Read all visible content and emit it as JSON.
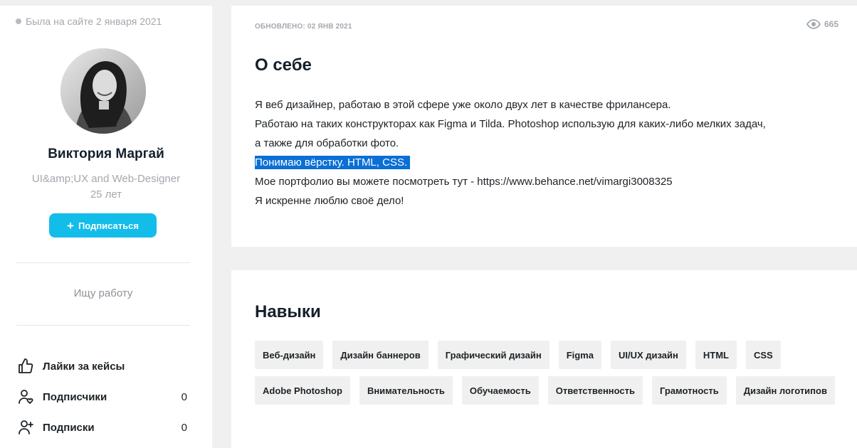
{
  "sidebar": {
    "last_seen": "Была на сайте 2 января 2021",
    "name": "Виктория Маргай",
    "title": "UI&amp;UX and Web-Designer",
    "age": "25 лет",
    "subscribe_label": "Подписаться",
    "job_status": "Ищу работу",
    "stats": [
      {
        "label": "Лайки за кейсы",
        "count": "",
        "icon": "thumbs-up-icon"
      },
      {
        "label": "Подписчики",
        "count": "0",
        "icon": "user-heart-icon"
      },
      {
        "label": "Подписки",
        "count": "0",
        "icon": "user-plus-icon"
      }
    ]
  },
  "about": {
    "updated": "ОБНОВЛЕНО: 02 ЯНВ 2021",
    "views": "665",
    "title": "О себе",
    "lines": [
      "Я веб дизайнер, работаю в этой сфере уже около двух лет в качестве фрилансера.",
      "Работаю на таких конструкторах как Figma и Tilda. Photoshop использую для каких-либо мелких задач,",
      "а также для обработки фото.",
      "Понимаю вёрстку. HTML, CSS.",
      "Мое портфолио вы можете посмотреть тут - https://www.behance.net/vimargi3008325",
      "Я искренне люблю своё дело!"
    ]
  },
  "skills": {
    "title": "Навыки",
    "items": [
      "Веб-дизайн",
      "Дизайн баннеров",
      "Графический дизайн",
      "Figma",
      "UI/UX дизайн",
      "HTML",
      "CSS",
      "Adobe Photoshop",
      "Внимательность",
      "Обучаемость",
      "Ответственность",
      "Грамотность",
      "Дизайн логотипов"
    ]
  },
  "colors": {
    "accent": "#12bde9",
    "selection": "#0a6fd6",
    "muted": "#a3a8ad",
    "background": "#f0f0f0"
  }
}
